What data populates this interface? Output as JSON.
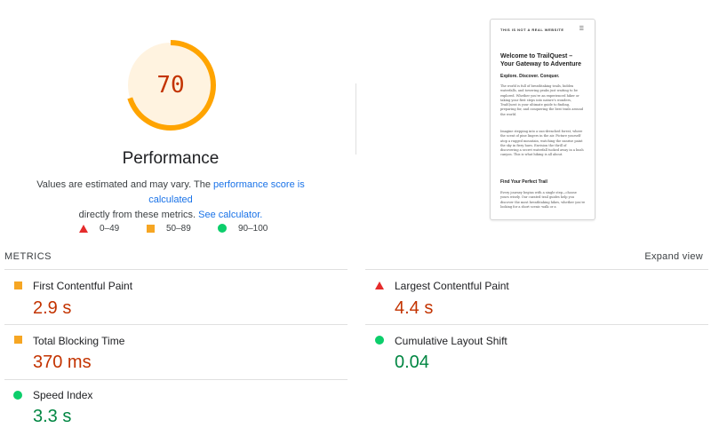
{
  "gauge": {
    "score": "70",
    "fraction": 0.7,
    "color": "#ffa400",
    "bg_color": "#fff3e0"
  },
  "performance": {
    "title": "Performance",
    "desc_prefix": "Values are estimated and may vary. The ",
    "score_link": "performance score is calculated",
    "desc_middle": "directly from these metrics. ",
    "calculator_link": "See calculator."
  },
  "legend": {
    "fail": "0–49",
    "average": "50–89",
    "pass": "90–100"
  },
  "preview": {
    "brand": "THIS IS NOT A REAL WEBSITE",
    "heading": "Welcome to TrailQuest – Your Gateway to Adventure",
    "subheading": "Explore. Discover. Conquer.",
    "para1": "The world is full of breathtaking trails, hidden waterfalls, and towering peaks just waiting to be explored. Whether you're an experienced hiker or taking your first steps into nature's wonders, TrailQuest is your ultimate guide to finding, preparing for, and conquering the best trails around the world.",
    "para2": "Imagine stepping into a sun-drenched forest, where the scent of pine lingers in the air. Picture yourself atop a rugged mountain, watching the sunrise paint the sky in fiery hues. Envision the thrill of discovering a secret waterfall tucked away in a hush canyon. This is what hiking is all about.",
    "heading2": "Find Your Perfect Trail",
    "para3": "Every journey begins with a single step—choose yours wisely. Our curated trail guides help you discover the most breathtaking hikes, whether you're looking for a short scenic walk or a"
  },
  "metrics": {
    "label": "METRICS",
    "expand": "Expand view",
    "items": [
      {
        "title": "First Contentful Paint",
        "value": "2.9 s",
        "status": "average"
      },
      {
        "title": "Largest Contentful Paint",
        "value": "4.4 s",
        "status": "fail"
      },
      {
        "title": "Total Blocking Time",
        "value": "370 ms",
        "status": "average"
      },
      {
        "title": "Cumulative Layout Shift",
        "value": "0.04",
        "status": "pass"
      },
      {
        "title": "Speed Index",
        "value": "3.3 s",
        "status": "average-pass"
      }
    ]
  },
  "colors": {
    "fail": "#e52b2b",
    "average": "#f6a623",
    "pass": "#0cce6b",
    "fail_text": "#c33300",
    "pass_text": "#018642",
    "link": "#1a73e8"
  }
}
